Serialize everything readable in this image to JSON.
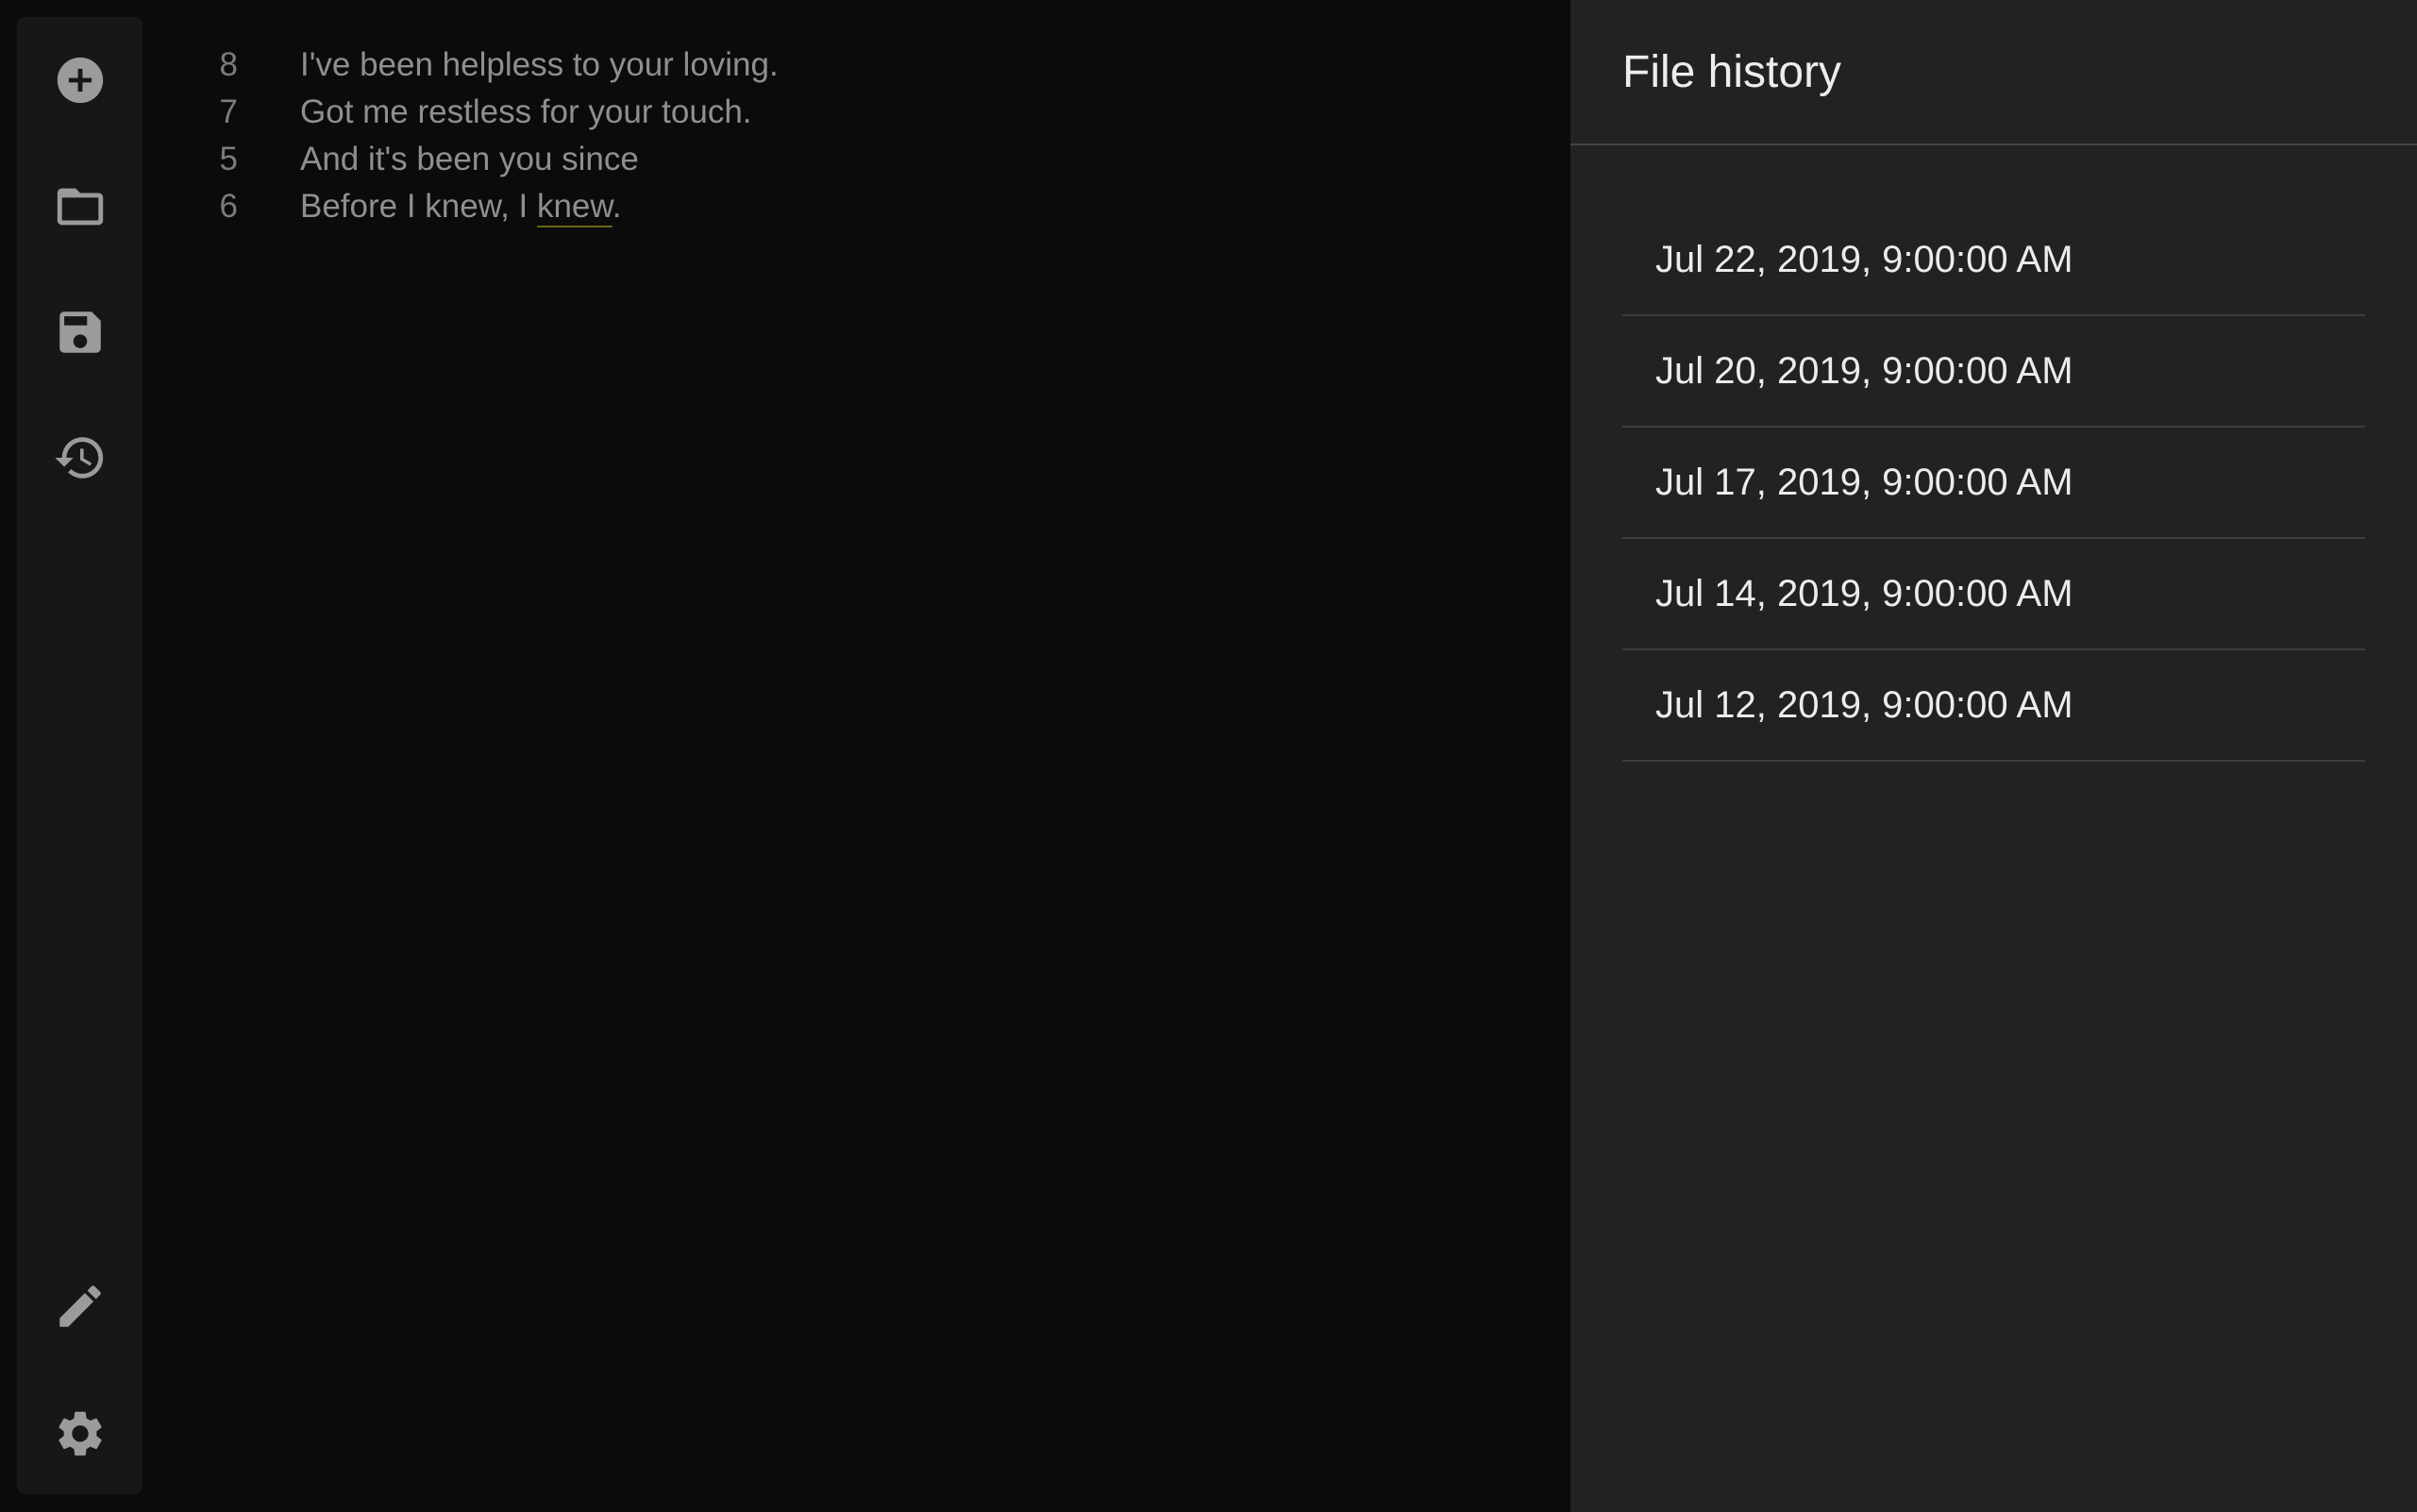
{
  "sidebar": {
    "buttons": [
      {
        "name": "new",
        "icon": "add-circle-icon"
      },
      {
        "name": "open",
        "icon": "folder-icon"
      },
      {
        "name": "save",
        "icon": "save-icon"
      },
      {
        "name": "history",
        "icon": "history-icon"
      },
      {
        "name": "edit",
        "icon": "pencil-icon"
      },
      {
        "name": "settings",
        "icon": "gear-icon"
      }
    ]
  },
  "editor": {
    "lines": [
      {
        "number": "8",
        "text": "I've been helpless to your loving."
      },
      {
        "number": "7",
        "text": "Got me restless for your touch."
      },
      {
        "number": "5",
        "text": "And it's been you since"
      },
      {
        "number": "6",
        "text_before": "Before I knew, I ",
        "text_underlined": "knew",
        "text_after": "."
      }
    ]
  },
  "history_panel": {
    "title": "File history",
    "items": [
      "Jul 22, 2019, 9:00:00 AM",
      "Jul 20, 2019, 9:00:00 AM",
      "Jul 17, 2019, 9:00:00 AM",
      "Jul 14, 2019, 9:00:00 AM",
      "Jul 12, 2019, 9:00:00 AM"
    ]
  },
  "colors": {
    "editor_bg": "#0b0b0b",
    "sidebar_bg": "#171717",
    "panel_bg": "#222222",
    "icon": "#9b9b9b",
    "text_dim": "#8f8f8f",
    "text_bright": "#ececec"
  }
}
